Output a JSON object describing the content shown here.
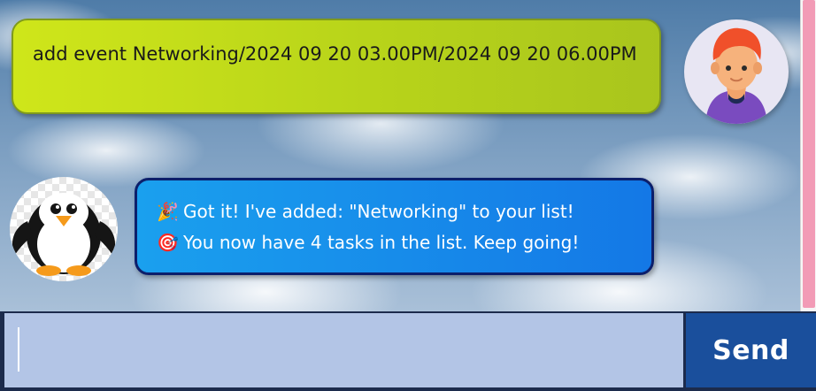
{
  "chat": {
    "messages": [
      {
        "sender": "user",
        "avatar_icon": "red-haired-person-avatar-icon",
        "text": "add event Networking/2024 09 20 03.00PM/2024 09 20 06.00PM"
      },
      {
        "sender": "bot",
        "avatar_icon": "penguin-avatar-icon",
        "lines": [
          {
            "emoji": "🎉",
            "icon_name": "party-popper-icon",
            "text": "Got it! I've added: \"Networking\" to your list!"
          },
          {
            "emoji": "🎯",
            "icon_name": "target-icon",
            "text": "You now have 4 tasks in the list. Keep going!"
          }
        ]
      }
    ]
  },
  "input": {
    "value": "",
    "placeholder": ""
  },
  "send_button": {
    "label": "Send"
  },
  "colors": {
    "user_bubble": "#bfdc1a",
    "bot_bubble": "#1a8cec",
    "send_button": "#1a4f9c",
    "input_bg": "#b3c5e6",
    "scrollbar_thumb": "#f29bb6"
  }
}
